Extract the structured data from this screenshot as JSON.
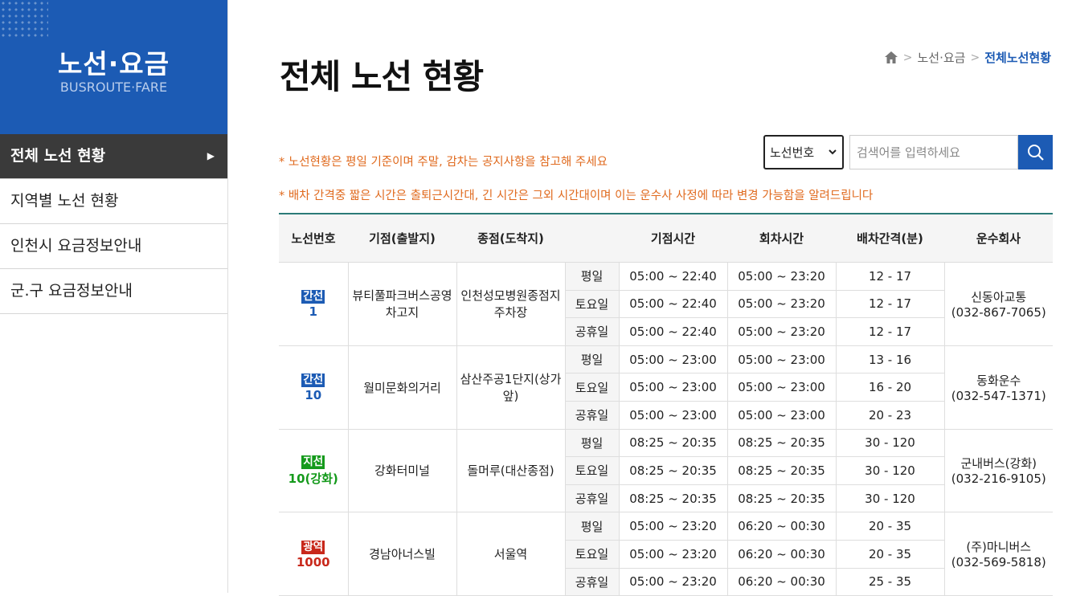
{
  "sidebar": {
    "title": "노선·요금",
    "subtitle": "BUSROUTE·FARE",
    "items": [
      {
        "label": "전체 노선 현황"
      },
      {
        "label": "지역별 노선 현황"
      },
      {
        "label": "인천시 요금정보안내"
      },
      {
        "label": "군.구 요금정보안내"
      }
    ]
  },
  "page": {
    "title": "전체 노선 현황",
    "breadcrumb": [
      "노선·요금",
      "전체노선현황"
    ]
  },
  "notes": [
    "* 노선현황은 평일 기준이며 주말, 감차는 공지사항을 참고해 주세요",
    "* 배차 간격중 짧은 시간은 출퇴근시간대, 긴 시간은 그외 시간대이며 이는 운수사 사정에 따라 변경 가능함을 알려드립니다"
  ],
  "search": {
    "select_value": "노선번호",
    "placeholder": "검색어를 입력하세요"
  },
  "colors": {
    "primary": "#1c5bb4",
    "note": "#e06a1e",
    "trunk": "#1c5bb4",
    "branch": "#159a1c",
    "metro": "#c8281b"
  },
  "table": {
    "headers": [
      "노선번호",
      "기점(출발지)",
      "종점(도착지)",
      "",
      "기점시간",
      "회차시간",
      "배차간격(분)",
      "운수회사"
    ],
    "routes": [
      {
        "type": "간선",
        "number": "1",
        "color": "blue",
        "start": "뷰티풀파크버스공영차고지",
        "end": "인천성모병원종점지주차장",
        "company": "신동아교통",
        "phone": "(032-867-7065)",
        "rows": [
          {
            "day": "평일",
            "start_time": "05:00 ~ 22:40",
            "return_time": "05:00 ~ 23:20",
            "interval": "12 - 17"
          },
          {
            "day": "토요일",
            "start_time": "05:00 ~ 22:40",
            "return_time": "05:00 ~ 23:20",
            "interval": "12 - 17"
          },
          {
            "day": "공휴일",
            "start_time": "05:00 ~ 22:40",
            "return_time": "05:00 ~ 23:20",
            "interval": "12 - 17"
          }
        ]
      },
      {
        "type": "간선",
        "number": "10",
        "color": "blue",
        "start": "월미문화의거리",
        "end": "삼산주공1단지(상가앞)",
        "company": "동화운수",
        "phone": "(032-547-1371)",
        "rows": [
          {
            "day": "평일",
            "start_time": "05:00 ~ 23:00",
            "return_time": "05:00 ~ 23:00",
            "interval": "13 - 16"
          },
          {
            "day": "토요일",
            "start_time": "05:00 ~ 23:00",
            "return_time": "05:00 ~ 23:00",
            "interval": "16 - 20"
          },
          {
            "day": "공휴일",
            "start_time": "05:00 ~ 23:00",
            "return_time": "05:00 ~ 23:00",
            "interval": "20 - 23"
          }
        ]
      },
      {
        "type": "지선",
        "number": "10(강화)",
        "color": "green",
        "start": "강화터미널",
        "end": "돌머루(대산종점)",
        "company": "군내버스(강화)",
        "phone": "(032-216-9105)",
        "rows": [
          {
            "day": "평일",
            "start_time": "08:25 ~ 20:35",
            "return_time": "08:25 ~ 20:35",
            "interval": "30 - 120"
          },
          {
            "day": "토요일",
            "start_time": "08:25 ~ 20:35",
            "return_time": "08:25 ~ 20:35",
            "interval": "30 - 120"
          },
          {
            "day": "공휴일",
            "start_time": "08:25 ~ 20:35",
            "return_time": "08:25 ~ 20:35",
            "interval": "30 - 120"
          }
        ]
      },
      {
        "type": "광역",
        "number": "1000",
        "color": "red",
        "start": "경남아너스빌",
        "end": "서울역",
        "company": "(주)마니버스",
        "phone": "(032-569-5818)",
        "rows": [
          {
            "day": "평일",
            "start_time": "05:00 ~ 23:20",
            "return_time": "06:20 ~ 00:30",
            "interval": "20 - 35"
          },
          {
            "day": "토요일",
            "start_time": "05:00 ~ 23:20",
            "return_time": "06:20 ~ 00:30",
            "interval": "20 - 35"
          },
          {
            "day": "공휴일",
            "start_time": "05:00 ~ 23:20",
            "return_time": "06:20 ~ 00:30",
            "interval": "25 - 35"
          }
        ]
      }
    ]
  }
}
